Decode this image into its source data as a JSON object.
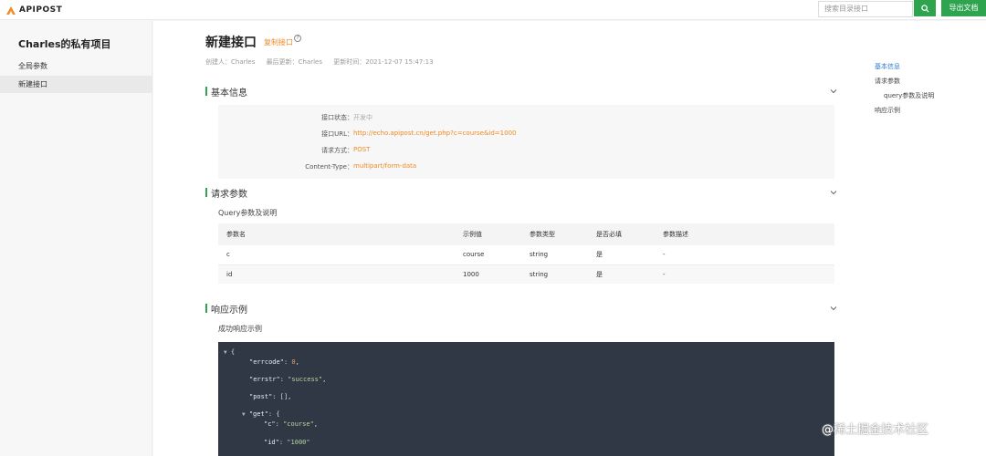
{
  "topbar": {
    "logo_text": "APIPOST",
    "search_placeholder": "搜索目录接口",
    "export_label": "导出文档"
  },
  "sidebar": {
    "project_name": "Charles的私有项目",
    "items": [
      {
        "label": "全局参数",
        "active": false
      },
      {
        "label": "新建接口",
        "active": true
      }
    ]
  },
  "header": {
    "title": "新建接口",
    "copy_label": "复制接口",
    "help_glyph": "?",
    "creator": "创建人：Charles",
    "updater": "最后更新：Charles",
    "updated_at": "更新时间：2021-12-07 15:47:13"
  },
  "basic_info": {
    "title": "基本信息",
    "rows": [
      {
        "label": "接口状态：",
        "value": "开发中"
      },
      {
        "label": "接口URL：",
        "value": "http://echo.apipost.cn/get.php?c=course&id=1000"
      },
      {
        "label": "请求方式：",
        "value": "POST"
      },
      {
        "label": "Content-Type：",
        "value": "multipart/form-data"
      }
    ]
  },
  "request_params": {
    "title": "请求参数",
    "sub_title": "Query参数及说明",
    "columns": [
      "参数名",
      "示例值",
      "参数类型",
      "是否必填",
      "参数描述"
    ],
    "rows": [
      [
        "c",
        "course",
        "string",
        "是",
        "-"
      ],
      [
        "id",
        "1000",
        "string",
        "是",
        "-"
      ]
    ]
  },
  "response": {
    "title": "响应示例",
    "sub_title": "成功响应示例",
    "code": {
      "open": "{",
      "k_errcode": "\"errcode\"",
      "v_errcode": "0",
      "k_errstr": "\"errstr\"",
      "v_errstr": "\"success\"",
      "k_post": "\"post\"",
      "v_post": "[],",
      "k_get": "\"get\"",
      "v_get_open": "{",
      "k_c": "\"c\"",
      "v_c": "\"course\"",
      "k_id": "\"id\"",
      "v_id": "\"1000\"",
      "colon": ": ",
      "comma": ","
    }
  },
  "toc": {
    "items": [
      "基本信息",
      "请求参数",
      "query参数及说明",
      "响应示例"
    ]
  },
  "watermark": {
    "text": "@稀土掘金技术社区"
  },
  "colors": {
    "accent_green": "#2ea44f",
    "link_orange": "#f08a24",
    "toc_blue": "#2d7bd6",
    "code_bg": "#303846"
  }
}
